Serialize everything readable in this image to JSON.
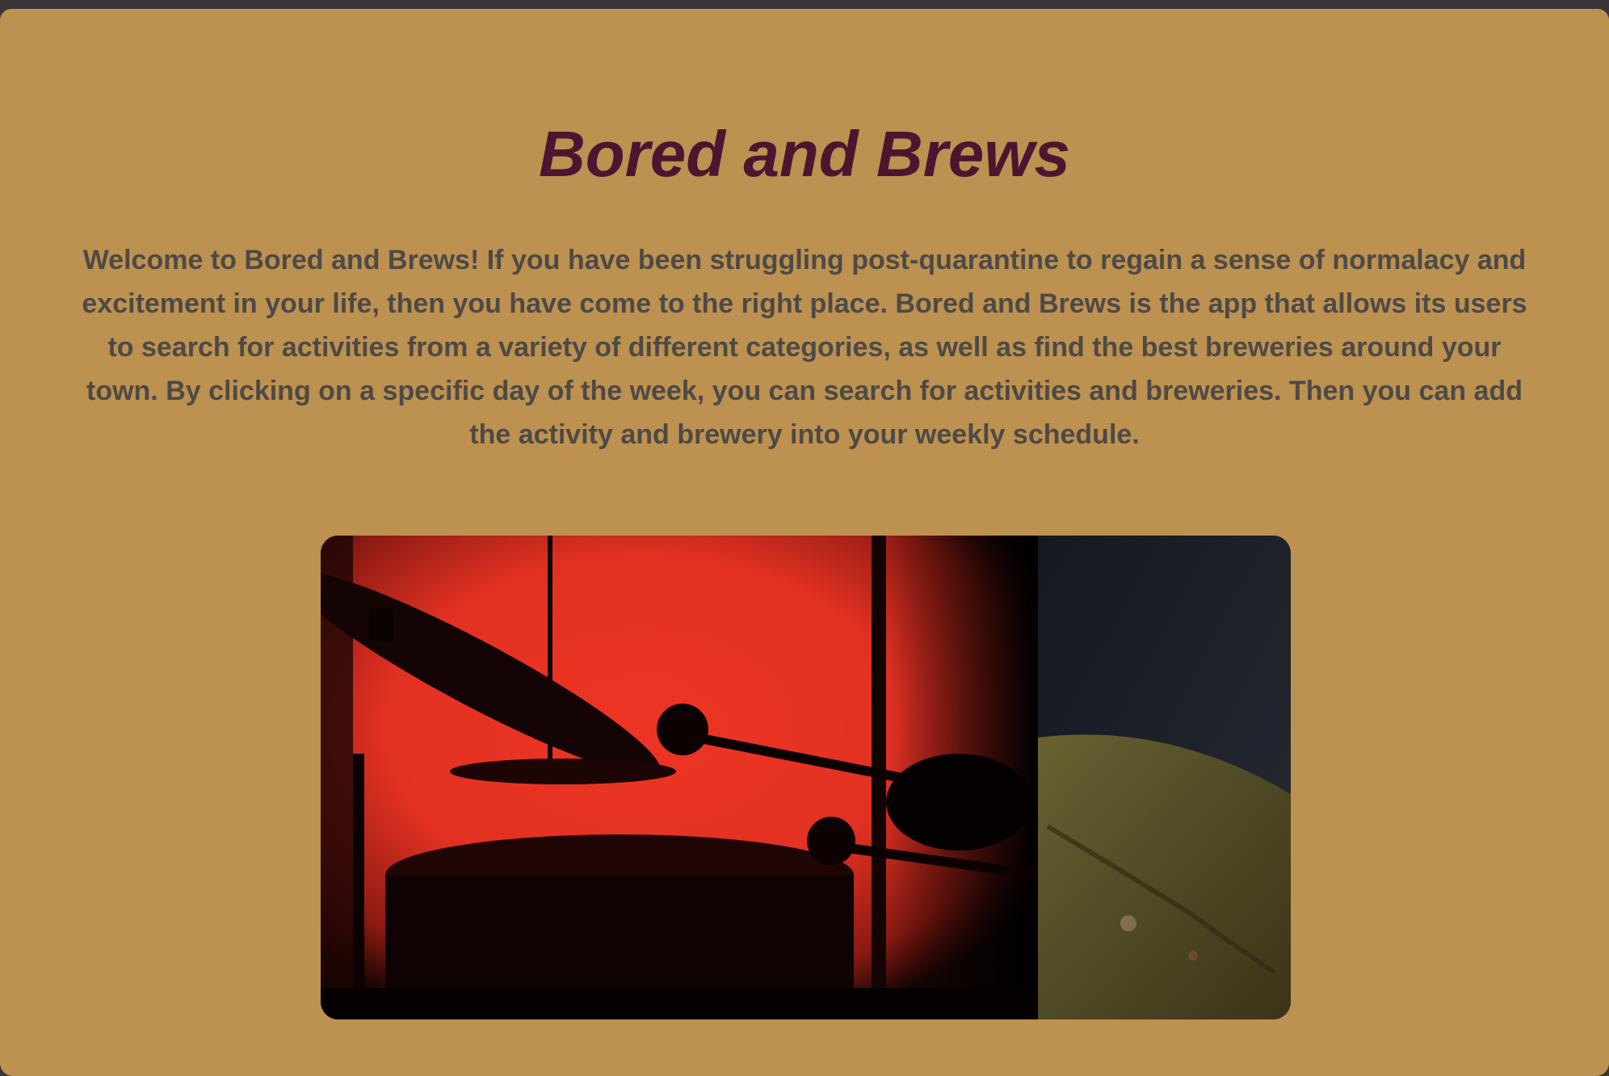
{
  "header": {
    "title": "Bored and Brews"
  },
  "intro": {
    "text": "Welcome to Bored and Brews! If you have been struggling post-quarantine to regain a sense of normalacy and excitement in your life, then you have come to the right place. Bored and Brews is the app that allows its users to search for activities from a variety of different categories, as well as find the best breweries around your town. By clicking on a specific day of the week, you can search for activities and breweries. Then you can add the activity and brewery into your weekly schedule."
  },
  "hero": {
    "slides": [
      "drummer-silhouette-photo",
      "brass-cymbal-photo"
    ]
  },
  "colors": {
    "background": "#bd9150",
    "title": "#4e1530",
    "body_text": "#4d4a46",
    "window_chrome": "#3a3539"
  }
}
